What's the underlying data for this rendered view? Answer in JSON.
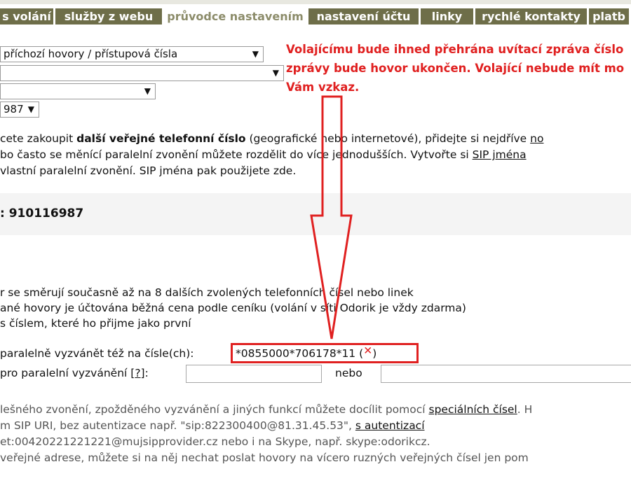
{
  "tabs": [
    {
      "label": "s volání"
    },
    {
      "label": "služby z webu"
    },
    {
      "label": "průvodce nastavením"
    },
    {
      "label": "nastavení účtu"
    },
    {
      "label": "linky"
    },
    {
      "label": "rychlé kontakty"
    },
    {
      "label": "platb"
    }
  ],
  "selects": {
    "s1": "příchozí hovory / přístupová čísla",
    "s4": "987"
  },
  "annotation": {
    "line1": "Volajícímu bude ihned přehrána uvítací zpráva číslo",
    "line2": "zprávy bude hovor ukončen. Volající nebude mít mo",
    "line3": "Vám vzkaz."
  },
  "info": {
    "p1_a": "cete zakoupit ",
    "p1_b": "další veřejné telefonní číslo",
    "p1_c": " (geografické nebo internetové), přidejte si nejdříve ",
    "p1_d": "no",
    "p2_a": "bo často se měnící paralelní zvonění můžete rozdělit do více jednodušších. Vytvořte si ",
    "p2_b": "SIP jména",
    "p3": " vlastní paralelní zvonění. SIP jména pak použijete zde."
  },
  "number_header": ": 910116987",
  "desc": {
    "d0": "",
    "d1": "r se směrují současně až na 8 dalších zvolených telefonních čísel nebo linek",
    "d2": "ané hovory je účtována běžná cena podle ceníku (volání v síti Odorik je vždy zdarma)",
    "d3": "s číslem, které ho přijme jako první"
  },
  "parallel": {
    "label": "paralelně vyzvánět též na čísle(ch):",
    "value": "*0855000*706178*11",
    "paren_open": "(",
    "paren_close": ")",
    "remove_glyph": "✕"
  },
  "second_row": {
    "label_a": " pro paralelní vyzvánění [",
    "help": "?",
    "label_b": "]:",
    "or": "nebo"
  },
  "footer": {
    "f1_a": "lešného zvonění, zpožděného vyzvánění a jiných funkcí můžete docílit pomocí ",
    "f1_b": "speciálních čísel",
    "f1_c": ". H",
    "f2_a": "m SIP URI, bez autentizace např. \"sip:822300400@81.31.45.53\", ",
    "f2_b": "s autentizací",
    "f3": "et:00420221221221@mujsipprovider.cz nebo i na Skype, např. skype:odorikcz.",
    "f4": "veřejné adrese, můžete si na něj nechat poslat hovory na vícero ruzných veřejných čísel jen pom"
  },
  "colors": {
    "tab_bg": "#6e6e49",
    "annotation_red": "#e02020"
  }
}
